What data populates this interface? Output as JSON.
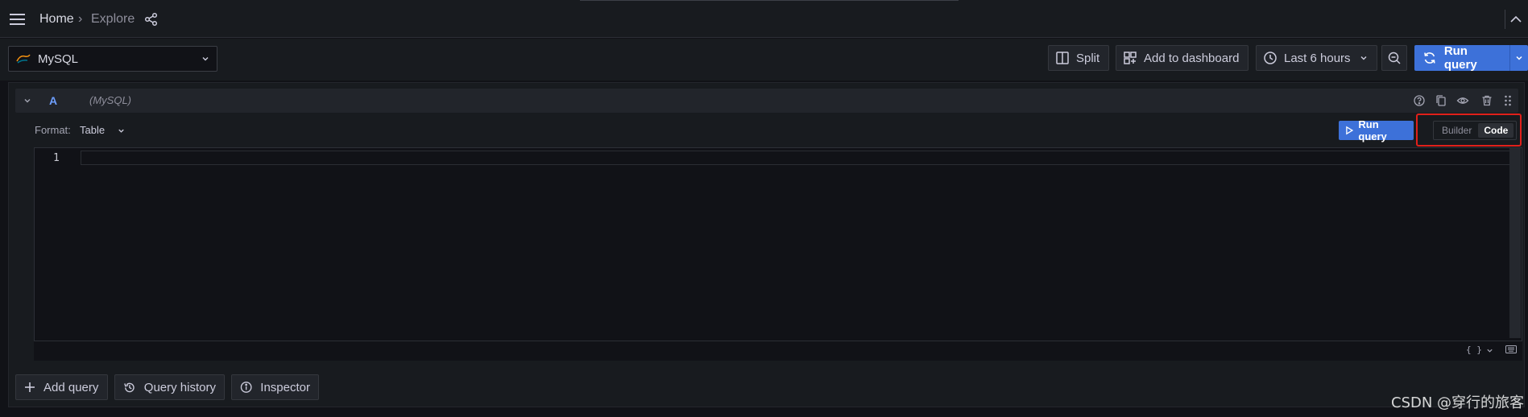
{
  "breadcrumb": {
    "home": "Home",
    "separator": "›",
    "current": "Explore"
  },
  "datasource": {
    "name": "MySQL"
  },
  "toolbar": {
    "split_label": "Split",
    "add_to_dashboard_label": "Add to dashboard",
    "time_range_label": "Last 6 hours",
    "run_query_label": "Run query"
  },
  "query": {
    "ref_id": "A",
    "datasource_hint": "(MySQL)",
    "format_label": "Format:",
    "format_value": "Table",
    "run_query_label": "Run query",
    "mode_builder": "Builder",
    "mode_code": "Code",
    "mode_selected": "Code",
    "line_number": "1",
    "format_icon_text": "{ }"
  },
  "bottom": {
    "add_query_label": "Add query",
    "query_history_label": "Query history",
    "inspector_label": "Inspector"
  },
  "watermark": "CSDN @穿行的旅客",
  "colors": {
    "primary": "#3d71d9",
    "highlight_box": "#e0201a",
    "background": "#111217",
    "panel": "#181b1f"
  }
}
